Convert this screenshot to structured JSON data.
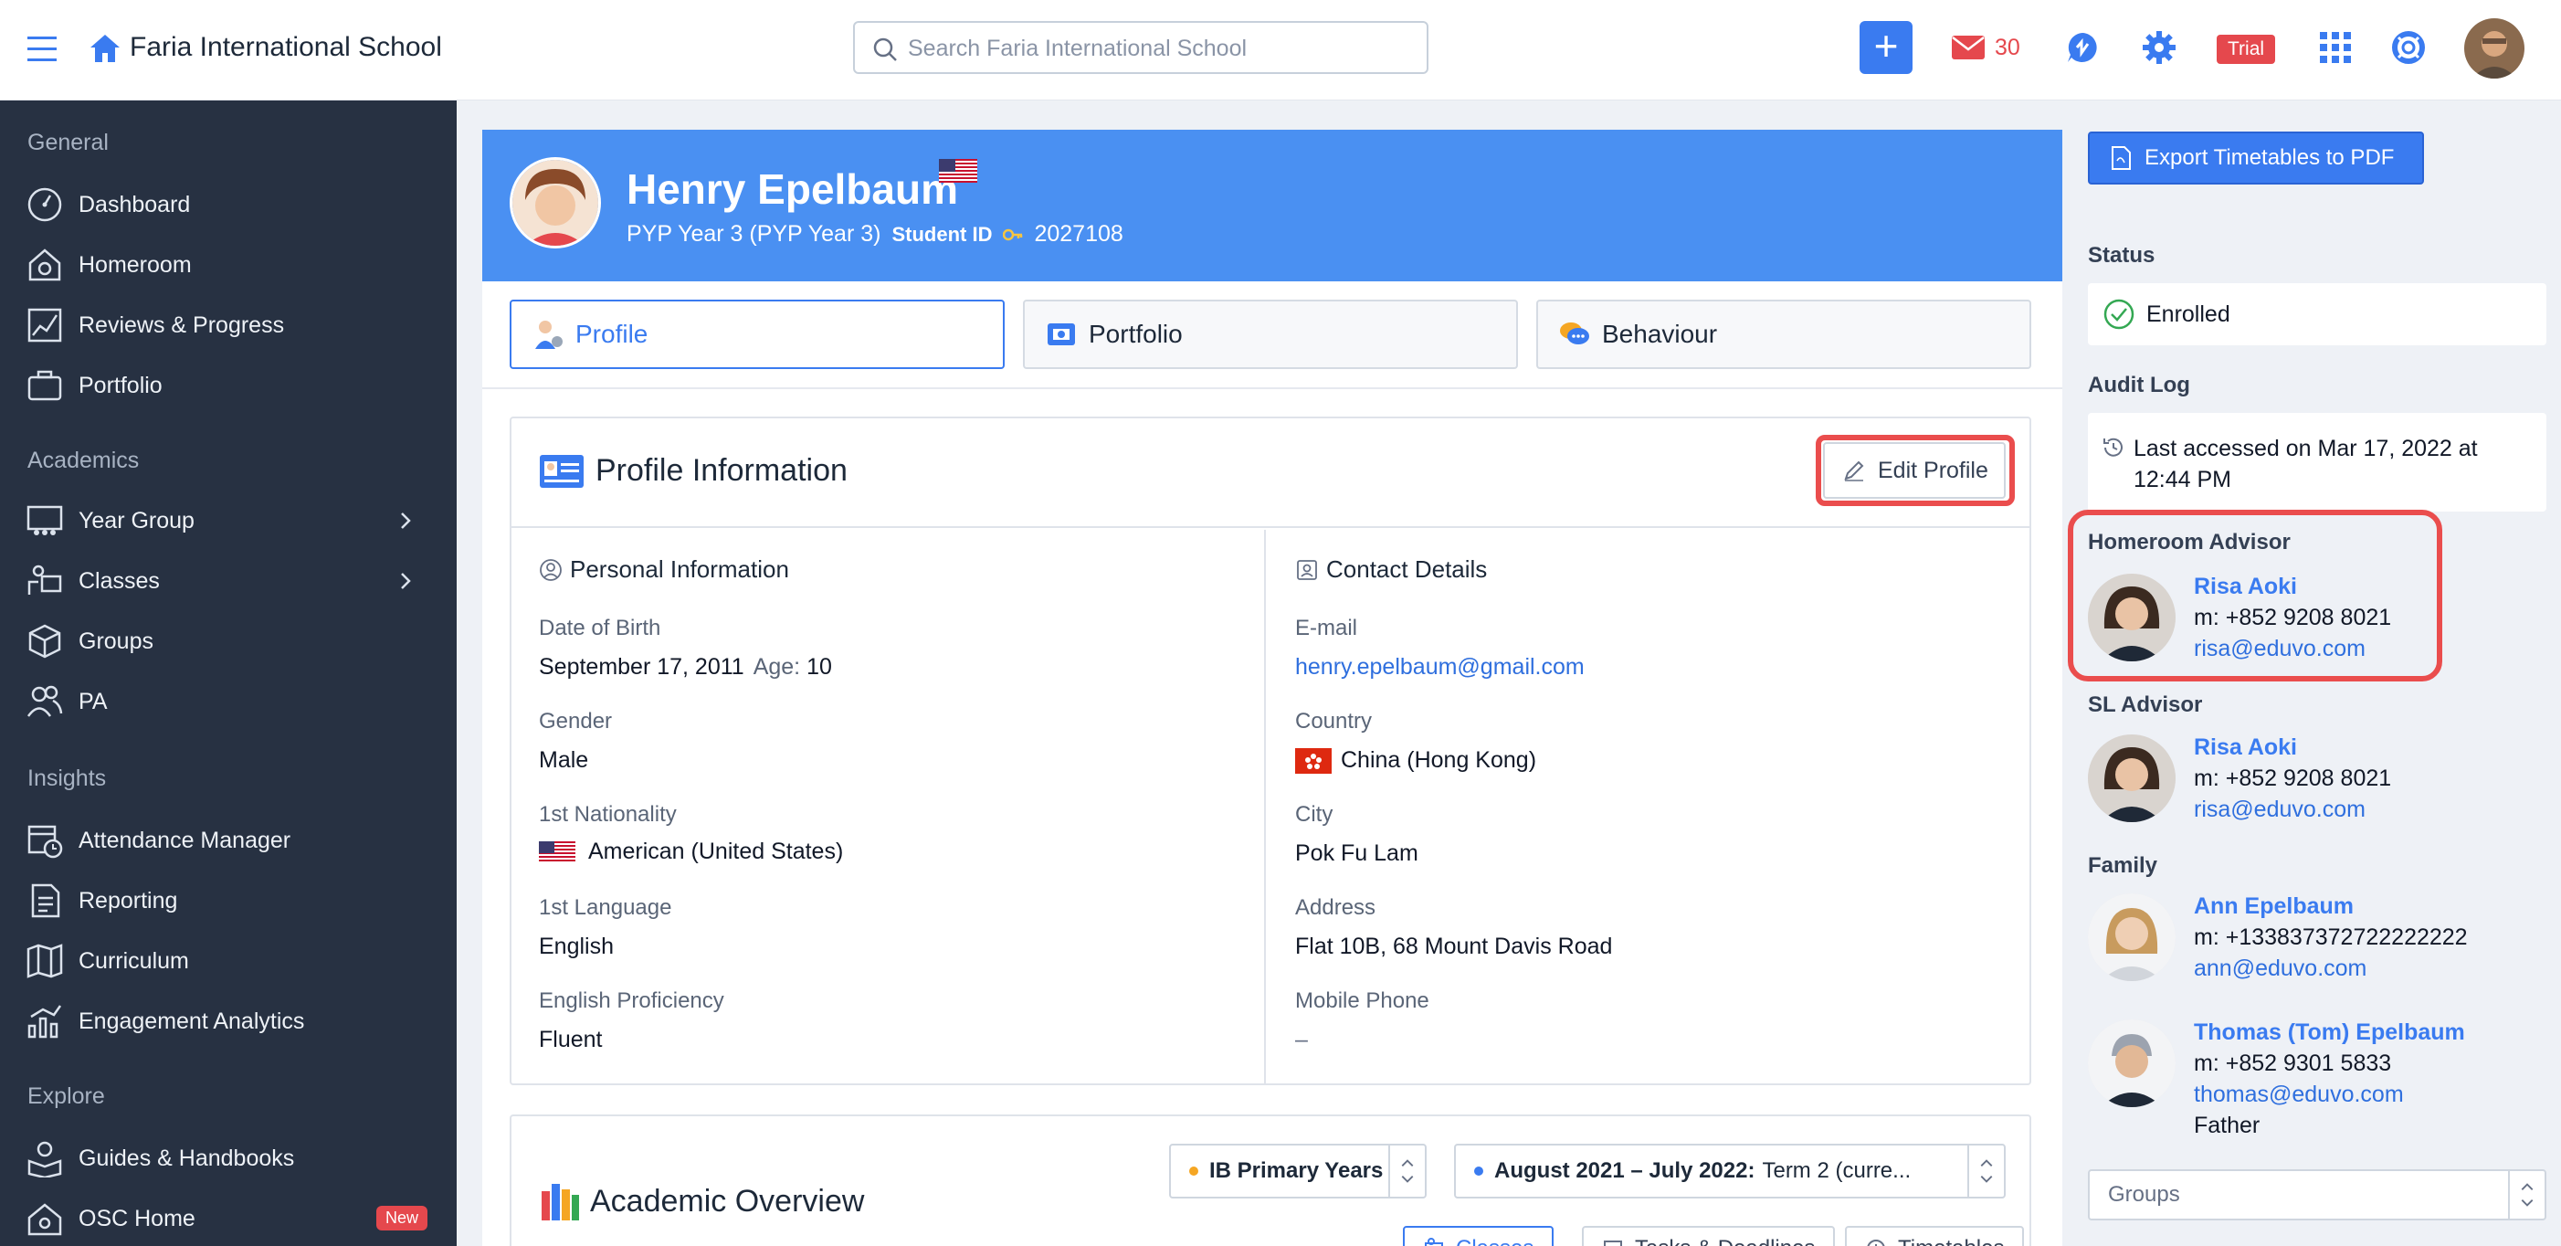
{
  "topbar": {
    "school_name": "Faria International School",
    "search_placeholder": "Search Faria International School",
    "mail_count": "30",
    "trial_label": "Trial",
    "plus_label": "+"
  },
  "sidebar": {
    "sections": [
      {
        "title": "General",
        "items": [
          "Dashboard",
          "Homeroom",
          "Reviews & Progress",
          "Portfolio"
        ]
      },
      {
        "title": "Academics",
        "items": [
          "Year Group",
          "Classes",
          "Groups",
          "PA"
        ]
      },
      {
        "title": "Insights",
        "items": [
          "Attendance Manager",
          "Reporting",
          "Curriculum",
          "Engagement Analytics"
        ]
      },
      {
        "title": "Explore",
        "items": [
          "Guides & Handbooks",
          "OSC Home"
        ]
      }
    ],
    "new_badge": "New"
  },
  "student": {
    "name": "Henry Epelbaum",
    "grade": "PYP Year 3 (PYP Year 3)",
    "id_label": "Student ID",
    "id_value": "2027108"
  },
  "tabs": [
    "Profile",
    "Portfolio",
    "Behaviour"
  ],
  "profile": {
    "title": "Profile Information",
    "edit_label": "Edit Profile",
    "personal": {
      "title": "Personal Information",
      "dob_label": "Date of Birth",
      "dob_value": "September 17, 2011",
      "age_label": "Age:",
      "age_value": "10",
      "gender_label": "Gender",
      "gender_value": "Male",
      "nationality_label": "1st Nationality",
      "nationality_value": "American (United States)",
      "language_label": "1st Language",
      "language_value": "English",
      "proficiency_label": "English Proficiency",
      "proficiency_value": "Fluent"
    },
    "contact": {
      "title": "Contact Details",
      "email_label": "E-mail",
      "email_value": "henry.epelbaum@gmail.com",
      "country_label": "Country",
      "country_value": "China (Hong Kong)",
      "city_label": "City",
      "city_value": "Pok Fu Lam",
      "address_label": "Address",
      "address_value": "Flat 10B, 68 Mount Davis Road",
      "mobile_label": "Mobile Phone",
      "mobile_value": "–"
    }
  },
  "academic": {
    "title": "Academic Overview",
    "program": "IB Primary Years",
    "term_bold": "August 2021 – July 2022:",
    "term_rest": "Term 2 (curre...",
    "subtabs": [
      "Classes",
      "Tasks & Deadlines",
      "Timetables"
    ]
  },
  "right_panel": {
    "export_label": "Export Timetables to PDF",
    "status_label": "Status",
    "status_value": "Enrolled",
    "audit_label": "Audit Log",
    "audit_value": "Last accessed on Mar 17, 2022 at 12:44 PM",
    "homeroom_label": "Homeroom Advisor",
    "homeroom": {
      "name": "Risa Aoki",
      "phone": "m: +852 9208 8021",
      "email": "risa@eduvo.com"
    },
    "sl_label": "SL Advisor",
    "sl": {
      "name": "Risa Aoki",
      "phone": "m: +852 9208 8021",
      "email": "risa@eduvo.com"
    },
    "family_label": "Family",
    "family": [
      {
        "name": "Ann Epelbaum",
        "phone": "m: +133837372722222222",
        "email": "ann@eduvo.com",
        "relation": ""
      },
      {
        "name": "Thomas (Tom) Epelbaum",
        "phone": "m: +852 9301 5833",
        "email": "thomas@eduvo.com",
        "relation": "Father"
      }
    ],
    "groups_placeholder": "Groups"
  },
  "colors": {
    "accent": "#3a7bf0",
    "header_band": "#4a90f2",
    "sidebar_bg": "#273142",
    "alert_red": "#e5484d",
    "highlight": "#ea4d4d"
  }
}
